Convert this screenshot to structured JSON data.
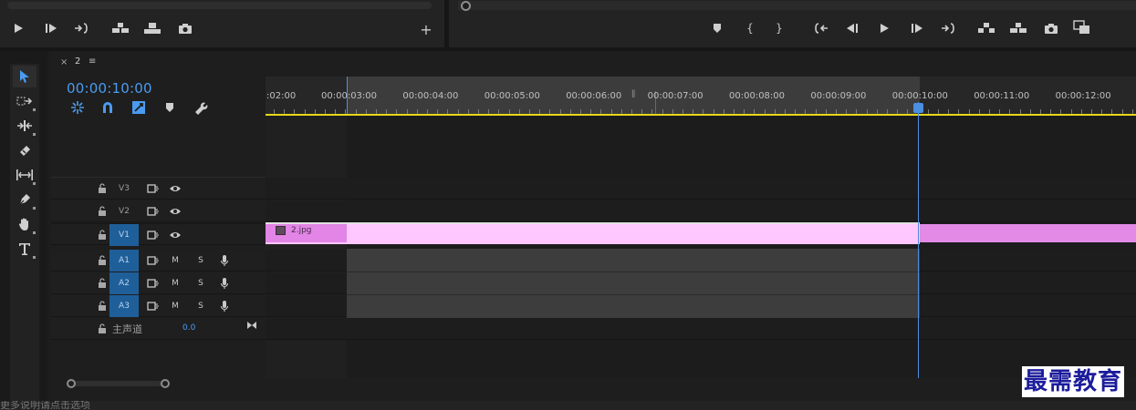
{
  "source_monitor": {
    "controls": [
      {
        "name": "play-button",
        "icon": "play-icon"
      },
      {
        "name": "step-forward-button",
        "icon": "step-forward-icon"
      },
      {
        "name": "go-to-out-button",
        "icon": "go-to-out-icon"
      },
      {
        "name": "insert-button",
        "icon": "insert-icon"
      },
      {
        "name": "overwrite-button",
        "icon": "overwrite-icon"
      },
      {
        "name": "export-frame-button",
        "icon": "camera-icon"
      }
    ],
    "add_label": "+"
  },
  "program_monitor": {
    "controls": [
      {
        "name": "add-marker-button",
        "icon": "marker-icon"
      },
      {
        "name": "mark-in-button",
        "label": "{"
      },
      {
        "name": "mark-out-button",
        "label": "}"
      },
      {
        "name": "go-to-in-button",
        "icon": "go-to-in-icon"
      },
      {
        "name": "step-back-button",
        "icon": "step-back-icon"
      },
      {
        "name": "play-button",
        "icon": "play-icon"
      },
      {
        "name": "step-forward-button",
        "icon": "step-forward-icon"
      },
      {
        "name": "go-to-out-button",
        "icon": "go-to-out-icon"
      },
      {
        "name": "lift-button",
        "icon": "lift-icon"
      },
      {
        "name": "extract-button",
        "icon": "extract-icon"
      },
      {
        "name": "export-frame-button",
        "icon": "camera-icon"
      },
      {
        "name": "compare-view-button",
        "icon": "compare-icon"
      }
    ]
  },
  "timeline": {
    "close": "×",
    "sequence_name": "2",
    "menu": "≡",
    "timecode": "00:00:10:00",
    "ruler_labels": [
      ":02:00",
      "00:00:03:00",
      "00:00:04:00",
      "00:00:05:00",
      "00:00:06:00",
      "00:00:07:00",
      "00:00:08:00",
      "00:00:09:00",
      "00:00:10:00",
      "00:00:11:00",
      "00:00:12:00"
    ],
    "video_tracks": [
      "V3",
      "V2",
      "V1"
    ],
    "audio_tracks": [
      "A1",
      "A2",
      "A3"
    ],
    "audio_buttons": {
      "mute": "M",
      "solo": "S"
    },
    "master": {
      "label": "主声道",
      "value": "0.0"
    },
    "clip": {
      "name": "2.jpg"
    }
  },
  "status_text": "更多说明请点击选项",
  "watermark": "最需教育",
  "colors": {
    "accent": "#4a9bf0",
    "clip_video": "#ffc7ff",
    "clip_video_head": "#e285e6",
    "track_selected": "#1f5f99",
    "ruler_line": "#e6d81a"
  }
}
